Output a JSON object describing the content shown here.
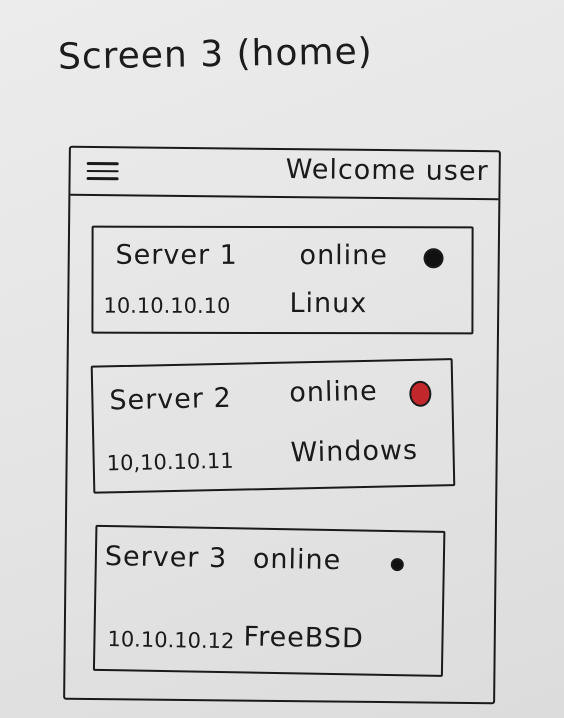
{
  "sketch_title": "Screen 3 (home)",
  "header": {
    "welcome_text": "Welcome user"
  },
  "servers": [
    {
      "name": "Server 1",
      "status": "online",
      "ip": "10.10.10.10",
      "os": "Linux",
      "status_color": "#111111"
    },
    {
      "name": "Server 2",
      "status": "online",
      "ip": "10,10.10.11",
      "os": "Windows",
      "status_color": "#c0282b"
    },
    {
      "name": "Server 3",
      "status": "online",
      "ip": "10.10.10.12",
      "os": "FreeBSD",
      "status_color": "#111111"
    }
  ],
  "icons": {
    "menu": "hamburger-menu-icon"
  }
}
